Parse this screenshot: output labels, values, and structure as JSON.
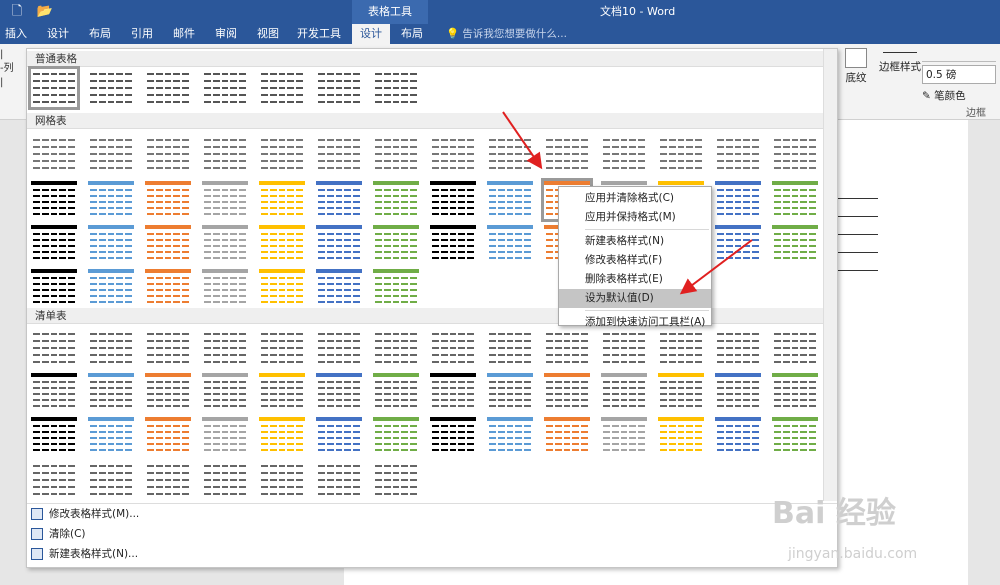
{
  "window": {
    "title": "文档10 - Word",
    "context_tab": "表格工具"
  },
  "qat_icons": [
    "new-doc-icon",
    "open-folder-icon"
  ],
  "tabs": [
    "插入",
    "设计",
    "布局",
    "引用",
    "邮件",
    "审阅",
    "视图",
    "开发工具",
    "设计",
    "布局"
  ],
  "active_tab_index": 8,
  "tell_me": "告诉我您想要做什么...",
  "ribbon_left_partial": [
    "|",
    "-列",
    "|"
  ],
  "ribbon": {
    "shading": "底纹",
    "border_styles": "边框样式",
    "pen_weight": "0.5 磅",
    "pen_color": "笔颜色",
    "group_label": "边框"
  },
  "gallery": {
    "sections": [
      "普通表格",
      "网格表",
      "清单表"
    ],
    "bottom_menu": [
      "修改表格样式(M)...",
      "清除(C)",
      "新建表格样式(N)..."
    ]
  },
  "context_menu": {
    "items": [
      "应用并清除格式(C)",
      "应用并保持格式(M)",
      "新建表格样式(N)",
      "修改表格样式(F)",
      "删除表格样式(E)",
      "设为默认值(D)",
      "添加到快速访问工具栏(A)"
    ],
    "highlighted_index": 5
  },
  "colors": {
    "title_bar": "#2b579a",
    "swatch_palette": [
      "#000000",
      "#5b9bd5",
      "#ed7d31",
      "#a5a5a5",
      "#ffc000",
      "#4472c4",
      "#70ad47"
    ],
    "arrow": "#e02020"
  },
  "watermark": {
    "main": "Bai 经验",
    "sub": "jingyan.baidu.com"
  }
}
